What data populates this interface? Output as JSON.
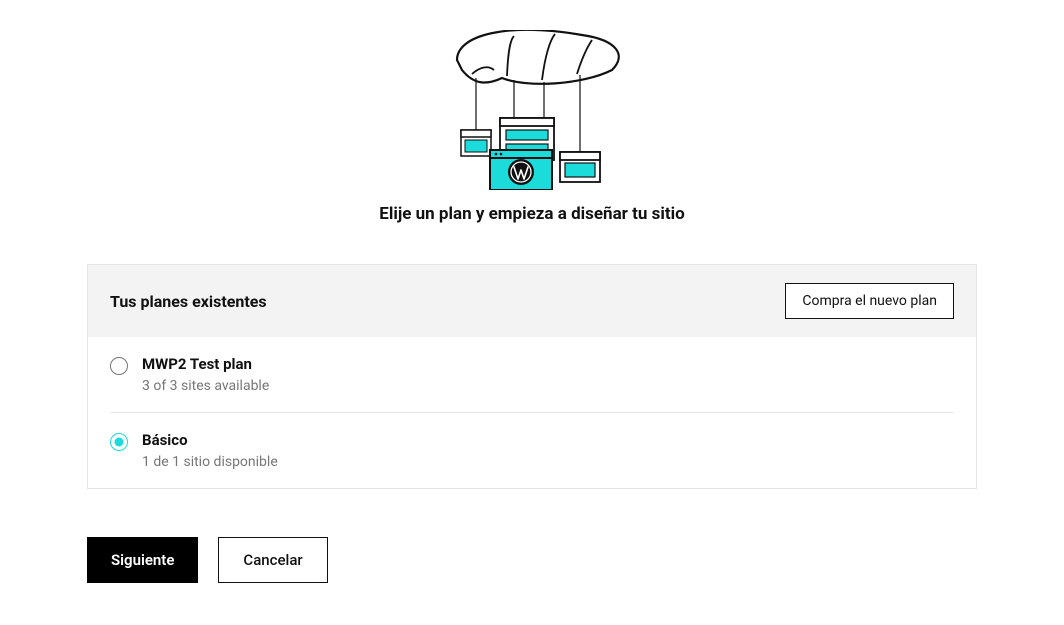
{
  "hero": {
    "title": "Elije un plan y empieza a diseñar tu sitio"
  },
  "plans_panel": {
    "header_title": "Tus planes existentes",
    "buy_button_label": "Compra el nuevo plan"
  },
  "plans": [
    {
      "name": "MWP2 Test plan",
      "subtitle": "3 of 3 sites available",
      "selected": false
    },
    {
      "name": "Básico",
      "subtitle": "1 de 1 sitio disponible",
      "selected": true
    }
  ],
  "actions": {
    "next_label": "Siguiente",
    "cancel_label": "Cancelar"
  },
  "colors": {
    "accent": "#1BDBDB",
    "primary": "#000000",
    "text": "#111111",
    "muted": "#767676"
  }
}
